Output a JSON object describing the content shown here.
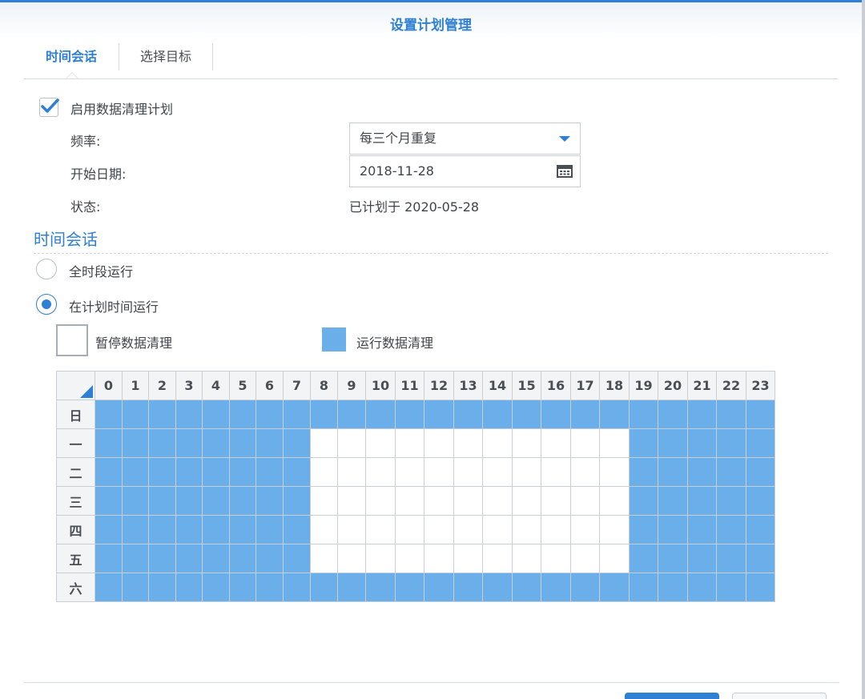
{
  "dialog": {
    "title": "设置计划管理"
  },
  "tabs": [
    {
      "label": "时间会话",
      "active": true
    },
    {
      "label": "选择目标",
      "active": false
    }
  ],
  "form": {
    "enable_label": "启用数据清理计划",
    "enable_checked": true,
    "frequency_label": "频率:",
    "frequency_value": "每三个月重复",
    "start_date_label": "开始日期:",
    "start_date_value": "2018-11-28",
    "status_label": "状态:",
    "status_value": "已计划于 2020-05-28"
  },
  "section": {
    "title": "时间会话",
    "radio_all": "全时段运行",
    "radio_scheduled": "在计划时间运行",
    "selected": "scheduled"
  },
  "legend": {
    "pause_label": "暂停数据清理",
    "run_label": "运行数据清理"
  },
  "schedule": {
    "hours": [
      "0",
      "1",
      "2",
      "3",
      "4",
      "5",
      "6",
      "7",
      "8",
      "9",
      "10",
      "11",
      "12",
      "13",
      "14",
      "15",
      "16",
      "17",
      "18",
      "19",
      "20",
      "21",
      "22",
      "23"
    ],
    "days": [
      "日",
      "一",
      "二",
      "三",
      "四",
      "五",
      "六"
    ],
    "grid": [
      "111111111111111111111111",
      "111111110000000000011111",
      "111111110000000000011111",
      "111111110000000000011111",
      "111111110000000000011111",
      "111111110000000000011111",
      "111111111111111111111111"
    ]
  },
  "colors": {
    "accent": "#2f80d5",
    "run_cell": "#6aaeea",
    "pause_cell": "#ffffff"
  }
}
